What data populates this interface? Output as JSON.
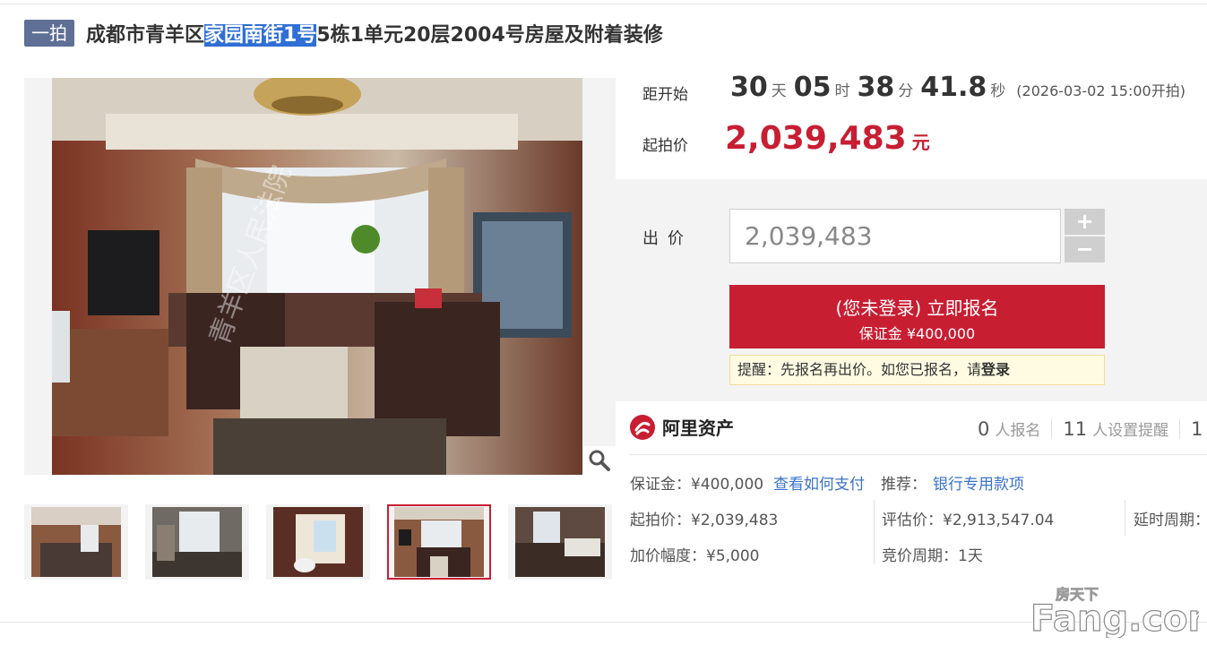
{
  "header": {
    "tag": "一拍",
    "title_part1": "成都市青羊区",
    "title_highlight": "家园南街1号",
    "title_part2": "5栋1单元20层2004号房屋及附着装修"
  },
  "gallery": {
    "photo_watermark": "青羊区人民法院",
    "zoom_icon": "magnifier-icon",
    "thumbnails": [
      "thumb-1",
      "thumb-2",
      "thumb-3",
      "thumb-4",
      "thumb-5"
    ],
    "active_index": 3
  },
  "countdown": {
    "label": "距开始",
    "days": "30",
    "days_unit": "天",
    "hours": "05",
    "hours_unit": "时",
    "minutes": "38",
    "minutes_unit": "分",
    "seconds": "41.8",
    "seconds_unit": "秒",
    "start_time": "(2026-03-02 15:00开拍)"
  },
  "start_price": {
    "label": "起拍价",
    "value": "2,039,483",
    "unit": "元"
  },
  "bid": {
    "label": "出价",
    "value": "2,039,483",
    "plus": "+",
    "minus": "−",
    "signup_line1": "(您未登录) 立即报名",
    "signup_line2": "保证金 ¥400,000",
    "tip_text": "提醒：先报名再出价。如您已报名，请",
    "tip_link": "登录"
  },
  "platform": {
    "name": "阿里资产",
    "logo_icon": "ali-asset-logo-icon",
    "registrants": "0",
    "registrants_label": "人报名",
    "reminders": "11",
    "reminders_label": "人设置提醒",
    "third_count": "1"
  },
  "details": {
    "deposit": "保证金：¥400,000",
    "pay_link": "查看如何支付",
    "recommend_label": "推荐：",
    "recommend_link": "银行专用款项",
    "start_price": "起拍价：¥2,039,483",
    "appraisal": "评估价：¥2,913,547.04",
    "delay": "延时周期：",
    "increment": "加价幅度：¥5,000",
    "bid_cycle": "竞价周期：1天"
  },
  "watermark": {
    "top": "房天下",
    "main": "Fang.com"
  },
  "colors": {
    "accent": "#c81e32",
    "tag_bg": "#5f6f96",
    "link": "#3a73c9",
    "highlight": "#2f6fd6"
  }
}
